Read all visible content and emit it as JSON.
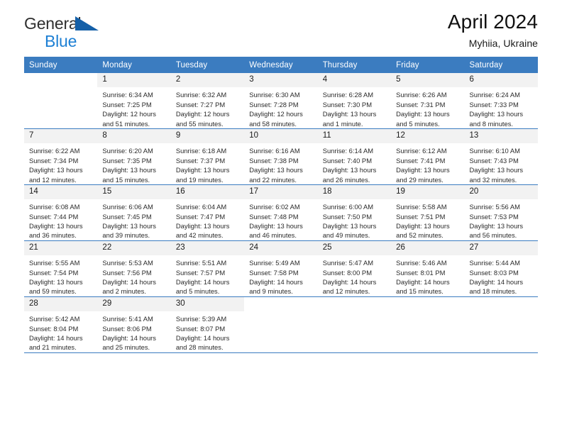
{
  "brand": {
    "word_general": "General",
    "word_blue": "Blue",
    "triangle_color": "#1560a8",
    "blue_color": "#1c7fd4"
  },
  "header": {
    "title": "April 2024",
    "subtitle": "Myhiia, Ukraine",
    "header_bg": "#3b7cc0",
    "daynum_bg": "#f2f2f2"
  },
  "weekdays": [
    "Sunday",
    "Monday",
    "Tuesday",
    "Wednesday",
    "Thursday",
    "Friday",
    "Saturday"
  ],
  "labels": {
    "sunrise_prefix": "Sunrise:",
    "sunset_prefix": "Sunset:",
    "daylight_prefix": "Daylight:"
  },
  "weeks": [
    {
      "days": [
        {
          "blank": true
        },
        {
          "num": "1",
          "sunrise": "Sunrise: 6:34 AM",
          "sunset": "Sunset: 7:25 PM",
          "daylight_l1": "Daylight: 12 hours",
          "daylight_l2": "and 51 minutes."
        },
        {
          "num": "2",
          "sunrise": "Sunrise: 6:32 AM",
          "sunset": "Sunset: 7:27 PM",
          "daylight_l1": "Daylight: 12 hours",
          "daylight_l2": "and 55 minutes."
        },
        {
          "num": "3",
          "sunrise": "Sunrise: 6:30 AM",
          "sunset": "Sunset: 7:28 PM",
          "daylight_l1": "Daylight: 12 hours",
          "daylight_l2": "and 58 minutes."
        },
        {
          "num": "4",
          "sunrise": "Sunrise: 6:28 AM",
          "sunset": "Sunset: 7:30 PM",
          "daylight_l1": "Daylight: 13 hours",
          "daylight_l2": "and 1 minute."
        },
        {
          "num": "5",
          "sunrise": "Sunrise: 6:26 AM",
          "sunset": "Sunset: 7:31 PM",
          "daylight_l1": "Daylight: 13 hours",
          "daylight_l2": "and 5 minutes."
        },
        {
          "num": "6",
          "sunrise": "Sunrise: 6:24 AM",
          "sunset": "Sunset: 7:33 PM",
          "daylight_l1": "Daylight: 13 hours",
          "daylight_l2": "and 8 minutes."
        }
      ]
    },
    {
      "days": [
        {
          "num": "7",
          "sunrise": "Sunrise: 6:22 AM",
          "sunset": "Sunset: 7:34 PM",
          "daylight_l1": "Daylight: 13 hours",
          "daylight_l2": "and 12 minutes."
        },
        {
          "num": "8",
          "sunrise": "Sunrise: 6:20 AM",
          "sunset": "Sunset: 7:35 PM",
          "daylight_l1": "Daylight: 13 hours",
          "daylight_l2": "and 15 minutes."
        },
        {
          "num": "9",
          "sunrise": "Sunrise: 6:18 AM",
          "sunset": "Sunset: 7:37 PM",
          "daylight_l1": "Daylight: 13 hours",
          "daylight_l2": "and 19 minutes."
        },
        {
          "num": "10",
          "sunrise": "Sunrise: 6:16 AM",
          "sunset": "Sunset: 7:38 PM",
          "daylight_l1": "Daylight: 13 hours",
          "daylight_l2": "and 22 minutes."
        },
        {
          "num": "11",
          "sunrise": "Sunrise: 6:14 AM",
          "sunset": "Sunset: 7:40 PM",
          "daylight_l1": "Daylight: 13 hours",
          "daylight_l2": "and 26 minutes."
        },
        {
          "num": "12",
          "sunrise": "Sunrise: 6:12 AM",
          "sunset": "Sunset: 7:41 PM",
          "daylight_l1": "Daylight: 13 hours",
          "daylight_l2": "and 29 minutes."
        },
        {
          "num": "13",
          "sunrise": "Sunrise: 6:10 AM",
          "sunset": "Sunset: 7:43 PM",
          "daylight_l1": "Daylight: 13 hours",
          "daylight_l2": "and 32 minutes."
        }
      ]
    },
    {
      "days": [
        {
          "num": "14",
          "sunrise": "Sunrise: 6:08 AM",
          "sunset": "Sunset: 7:44 PM",
          "daylight_l1": "Daylight: 13 hours",
          "daylight_l2": "and 36 minutes."
        },
        {
          "num": "15",
          "sunrise": "Sunrise: 6:06 AM",
          "sunset": "Sunset: 7:45 PM",
          "daylight_l1": "Daylight: 13 hours",
          "daylight_l2": "and 39 minutes."
        },
        {
          "num": "16",
          "sunrise": "Sunrise: 6:04 AM",
          "sunset": "Sunset: 7:47 PM",
          "daylight_l1": "Daylight: 13 hours",
          "daylight_l2": "and 42 minutes."
        },
        {
          "num": "17",
          "sunrise": "Sunrise: 6:02 AM",
          "sunset": "Sunset: 7:48 PM",
          "daylight_l1": "Daylight: 13 hours",
          "daylight_l2": "and 46 minutes."
        },
        {
          "num": "18",
          "sunrise": "Sunrise: 6:00 AM",
          "sunset": "Sunset: 7:50 PM",
          "daylight_l1": "Daylight: 13 hours",
          "daylight_l2": "and 49 minutes."
        },
        {
          "num": "19",
          "sunrise": "Sunrise: 5:58 AM",
          "sunset": "Sunset: 7:51 PM",
          "daylight_l1": "Daylight: 13 hours",
          "daylight_l2": "and 52 minutes."
        },
        {
          "num": "20",
          "sunrise": "Sunrise: 5:56 AM",
          "sunset": "Sunset: 7:53 PM",
          "daylight_l1": "Daylight: 13 hours",
          "daylight_l2": "and 56 minutes."
        }
      ]
    },
    {
      "days": [
        {
          "num": "21",
          "sunrise": "Sunrise: 5:55 AM",
          "sunset": "Sunset: 7:54 PM",
          "daylight_l1": "Daylight: 13 hours",
          "daylight_l2": "and 59 minutes."
        },
        {
          "num": "22",
          "sunrise": "Sunrise: 5:53 AM",
          "sunset": "Sunset: 7:56 PM",
          "daylight_l1": "Daylight: 14 hours",
          "daylight_l2": "and 2 minutes."
        },
        {
          "num": "23",
          "sunrise": "Sunrise: 5:51 AM",
          "sunset": "Sunset: 7:57 PM",
          "daylight_l1": "Daylight: 14 hours",
          "daylight_l2": "and 5 minutes."
        },
        {
          "num": "24",
          "sunrise": "Sunrise: 5:49 AM",
          "sunset": "Sunset: 7:58 PM",
          "daylight_l1": "Daylight: 14 hours",
          "daylight_l2": "and 9 minutes."
        },
        {
          "num": "25",
          "sunrise": "Sunrise: 5:47 AM",
          "sunset": "Sunset: 8:00 PM",
          "daylight_l1": "Daylight: 14 hours",
          "daylight_l2": "and 12 minutes."
        },
        {
          "num": "26",
          "sunrise": "Sunrise: 5:46 AM",
          "sunset": "Sunset: 8:01 PM",
          "daylight_l1": "Daylight: 14 hours",
          "daylight_l2": "and 15 minutes."
        },
        {
          "num": "27",
          "sunrise": "Sunrise: 5:44 AM",
          "sunset": "Sunset: 8:03 PM",
          "daylight_l1": "Daylight: 14 hours",
          "daylight_l2": "and 18 minutes."
        }
      ]
    },
    {
      "days": [
        {
          "num": "28",
          "sunrise": "Sunrise: 5:42 AM",
          "sunset": "Sunset: 8:04 PM",
          "daylight_l1": "Daylight: 14 hours",
          "daylight_l2": "and 21 minutes."
        },
        {
          "num": "29",
          "sunrise": "Sunrise: 5:41 AM",
          "sunset": "Sunset: 8:06 PM",
          "daylight_l1": "Daylight: 14 hours",
          "daylight_l2": "and 25 minutes."
        },
        {
          "num": "30",
          "sunrise": "Sunrise: 5:39 AM",
          "sunset": "Sunset: 8:07 PM",
          "daylight_l1": "Daylight: 14 hours",
          "daylight_l2": "and 28 minutes."
        },
        {
          "blank": true
        },
        {
          "blank": true
        },
        {
          "blank": true
        },
        {
          "blank": true
        }
      ]
    }
  ]
}
